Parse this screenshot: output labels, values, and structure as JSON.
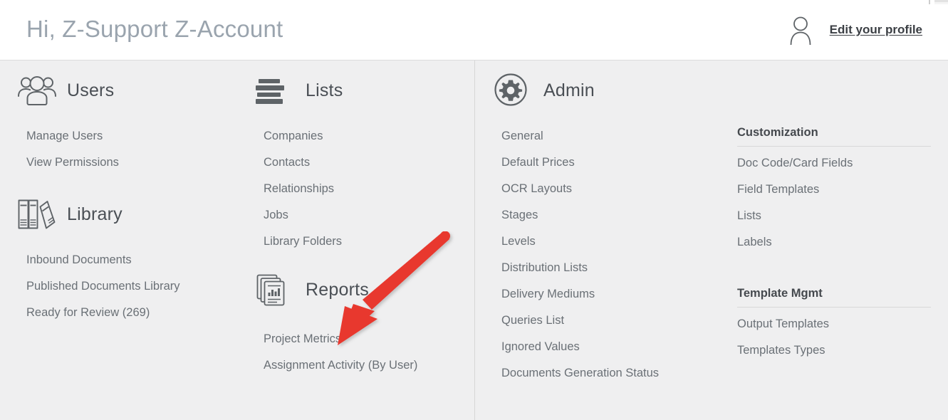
{
  "header": {
    "greeting": "Hi, Z-Support Z-Account",
    "edit_profile_label": "Edit your profile",
    "person_icon": "person-outline-icon"
  },
  "colors": {
    "page_background": "#efeff0",
    "header_background": "#ffffff",
    "greeting_text": "#9aa4ae",
    "section_title": "#4a4f55",
    "link_text": "#6a7076",
    "icon_stroke": "#5e6367",
    "divider": "#d6d6d6",
    "annotation_arrow": "#e8382e"
  },
  "sections": {
    "users": {
      "title": "Users",
      "icon": "users-group-icon",
      "links": [
        "Manage Users",
        "View Permissions"
      ]
    },
    "library": {
      "title": "Library",
      "icon": "books-icon",
      "links": [
        "Inbound Documents",
        "Published Documents Library",
        "Ready for Review (269)"
      ]
    },
    "lists": {
      "title": "Lists",
      "icon": "list-bars-icon",
      "links": [
        "Companies",
        "Contacts",
        "Relationships",
        "Jobs",
        "Library Folders"
      ]
    },
    "reports": {
      "title": "Reports",
      "icon": "reports-documents-chart-icon",
      "links": [
        "Project Metrics",
        "Assignment Activity (By User)"
      ]
    },
    "admin": {
      "title": "Admin",
      "icon": "gear-circle-icon",
      "links": [
        "General",
        "Default Prices",
        "OCR Layouts",
        "Stages",
        "Levels",
        "Distribution Lists",
        "Delivery Mediums",
        "Queries List",
        "Ignored Values",
        "Documents Generation Status"
      ]
    },
    "customization": {
      "title": "Customization",
      "links": [
        "Doc Code/Card Fields",
        "Field Templates",
        "Lists",
        "Labels"
      ]
    },
    "template_mgmt": {
      "title": "Template Mgmt",
      "links": [
        "Output Templates",
        "Templates Types"
      ]
    }
  },
  "annotation": {
    "type": "arrow",
    "color": "#e8382e",
    "points_to": "Project Metrics"
  }
}
